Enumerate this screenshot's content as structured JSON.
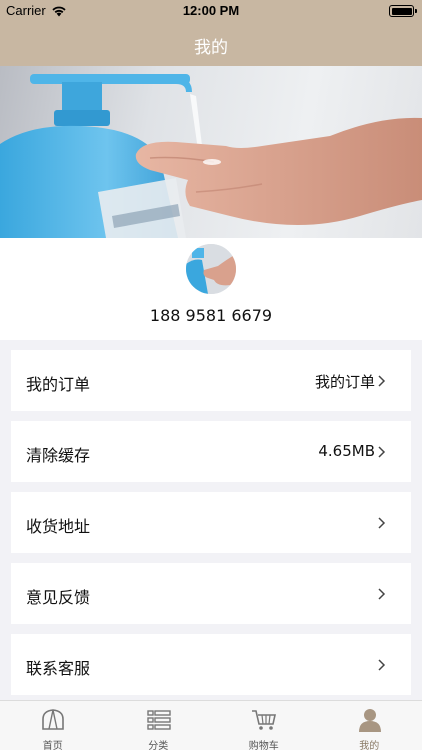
{
  "status_bar": {
    "carrier": "Carrier",
    "time": "12:00 PM"
  },
  "header": {
    "title": "我的"
  },
  "banner": {
    "image": "hand-sanitizer-banner"
  },
  "profile": {
    "phone": "188 9581 6679"
  },
  "menu": [
    {
      "label": "我的订单",
      "value": "我的订单",
      "icon": "chevron-right-icon"
    },
    {
      "label": "清除缓存",
      "value": "4.65MB",
      "icon": "chevron-right-icon"
    },
    {
      "label": "收货地址",
      "value": "",
      "icon": "chevron-right-icon"
    },
    {
      "label": "意见反馈",
      "value": "",
      "icon": "chevron-right-icon"
    },
    {
      "label": "联系客服",
      "value": "",
      "icon": "chevron-right-icon"
    }
  ],
  "tabs": [
    {
      "label": "首页",
      "icon": "home-icon"
    },
    {
      "label": "分类",
      "icon": "category-icon"
    },
    {
      "label": "购物车",
      "icon": "cart-icon"
    },
    {
      "label": "我的",
      "icon": "user-icon",
      "active": true
    }
  ],
  "colors": {
    "header_bg": "#c8b7a2",
    "page_bg": "#f2f2f6",
    "tab_active": "#8a7a66"
  }
}
